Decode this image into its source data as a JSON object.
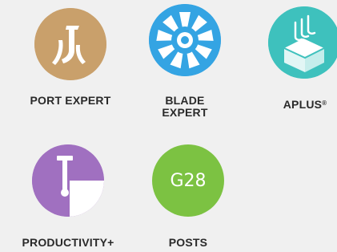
{
  "apps": [
    {
      "id": "port-expert",
      "label": "PORT EXPERT",
      "color": "#c9a06b",
      "icon": "port-expert-icon"
    },
    {
      "id": "blade-expert",
      "label_line1": "BLADE",
      "label_line2": "EXPERT",
      "color": "#34a4e3",
      "icon": "fan-icon"
    },
    {
      "id": "aplus",
      "label": "APLUS",
      "label_mark": "®",
      "color": "#3ec1bd",
      "icon": "aplus-icon"
    },
    {
      "id": "productivity-plus",
      "label": "PRODUCTIVITY+",
      "color": "#a070c0",
      "icon": "probe-icon"
    },
    {
      "id": "posts",
      "label": "POSTS",
      "icon_text": "G28",
      "color": "#7cc242",
      "icon": "g28-icon"
    }
  ]
}
